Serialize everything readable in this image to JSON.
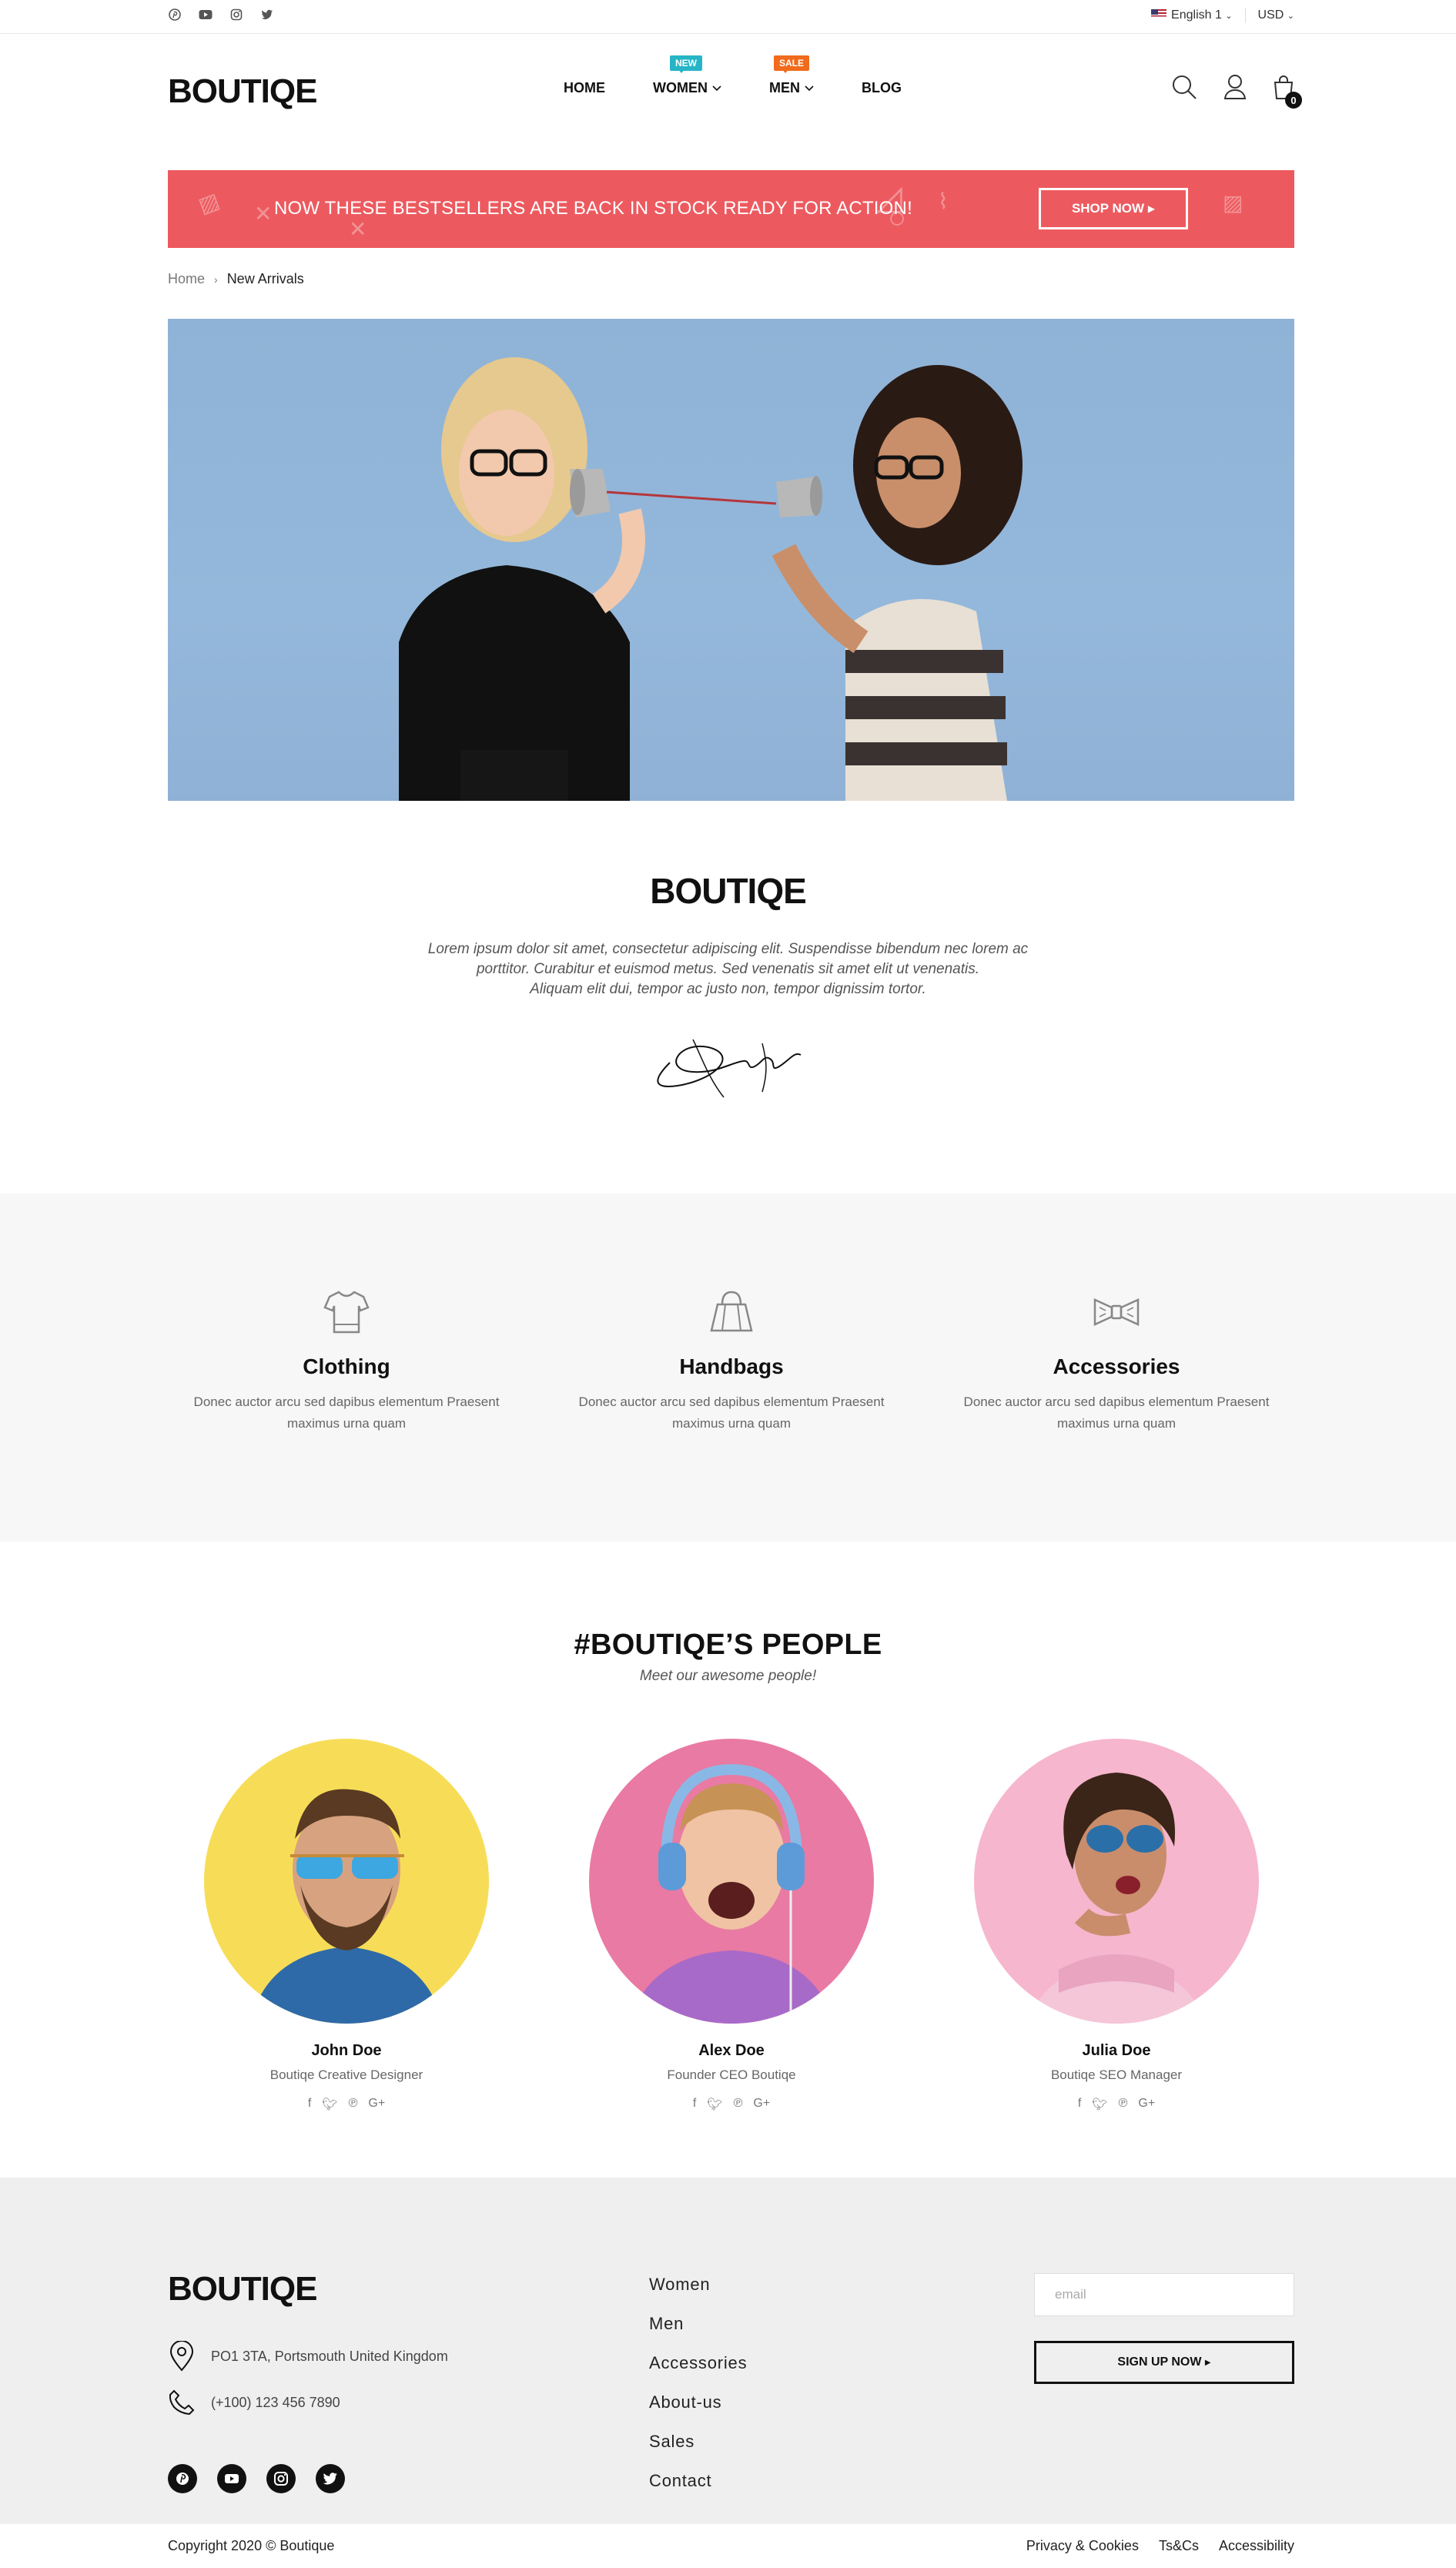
{
  "topbar": {
    "social_icons": [
      "pinterest-icon",
      "youtube-icon",
      "instagram-icon",
      "twitter-icon"
    ],
    "language": "English 1",
    "currency": "USD"
  },
  "header": {
    "logo": "BOUTIQE",
    "nav": [
      {
        "label": "HOME",
        "badge": null
      },
      {
        "label": "WOMEN",
        "badge": "NEW"
      },
      {
        "label": "MEN",
        "badge": "SALE"
      },
      {
        "label": "BLOG",
        "badge": null
      }
    ],
    "cart_count": "0",
    "colors": {
      "badge_new": "#26b5c6",
      "badge_sale": "#f06b1c"
    }
  },
  "promo": {
    "text": "NOW THESE BESTSELLERS ARE BACK IN STOCK READY FOR ACTION!",
    "button": "SHOP NOW",
    "color": "#ec5a5f"
  },
  "breadcrumb": {
    "home": "Home",
    "current": "New Arrivals"
  },
  "about": {
    "logo": "BOUTIQE",
    "text_lines": [
      "Lorem ipsum dolor sit amet, consectetur adipiscing elit. Suspendisse bibendum nec lorem ac",
      "porttitor. Curabitur et euismod metus. Sed venenatis sit amet elit ut venenatis.",
      "Aliquam elit dui, tempor ac justo non, tempor dignissim tortor."
    ]
  },
  "categories": [
    {
      "icon": "tshirt-icon",
      "title": "Clothing",
      "desc": "Donec auctor arcu sed dapibus elementum Praesent maximus urna quam"
    },
    {
      "icon": "handbag-icon",
      "title": "Handbags",
      "desc": "Donec auctor arcu sed dapibus elementum Praesent maximus urna quam"
    },
    {
      "icon": "bowtie-icon",
      "title": "Accessories",
      "desc": "Donec auctor arcu sed dapibus elementum Praesent maximus urna quam"
    }
  ],
  "people": {
    "title": "#BOUTIQE’S PEOPLE",
    "subtitle": "Meet our awesome people!",
    "members": [
      {
        "name": "John Doe",
        "role": "Boutiqe Creative Designer",
        "bg": "#f7dd57"
      },
      {
        "name": "Alex Doe",
        "role": "Founder CEO Boutiqe",
        "bg": "#e97aa3"
      },
      {
        "name": "Julia Doe",
        "role": "Boutiqe SEO Manager",
        "bg": "#f6b6cd"
      }
    ]
  },
  "footer": {
    "logo": "BOUTIQE",
    "address": "PO1 3TA, Portsmouth United Kingdom",
    "phone": "(+100) 123 456 7890",
    "links": [
      "Women",
      "Men",
      "Accessories",
      "About-us",
      "Sales",
      "Contact"
    ],
    "email_placeholder": "email",
    "signup": "SIGN UP NOW",
    "copyright": "Copyright 2020 © Boutique",
    "legal": [
      "Privacy & Cookies",
      "Ts&Cs",
      "Accessibility"
    ]
  }
}
